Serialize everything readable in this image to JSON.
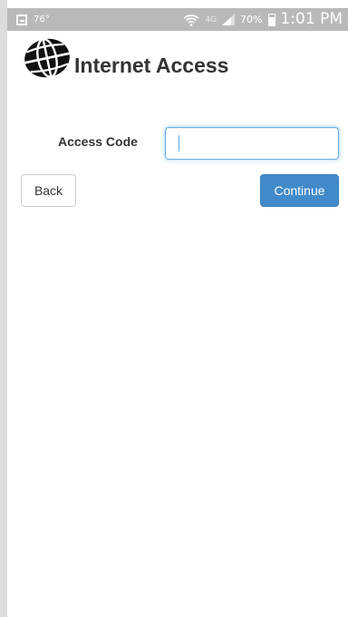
{
  "status_bar": {
    "temperature": "76°",
    "network": "4G",
    "battery_percent": "70%",
    "time": "1:01 PM",
    "icons": [
      "gallery-icon",
      "wifi-icon",
      "signal-icon",
      "battery-icon"
    ]
  },
  "header": {
    "logo_icon": "globe-icon",
    "title": "Internet Access"
  },
  "form": {
    "access_code_label": "Access Code",
    "access_code_value": "",
    "access_code_placeholder": ""
  },
  "buttons": {
    "back_label": "Back",
    "continue_label": "Continue"
  },
  "colors": {
    "primary": "#428bca",
    "input_focus": "#66afe9",
    "status_bar": "#b9b9b9",
    "text": "#333333"
  }
}
